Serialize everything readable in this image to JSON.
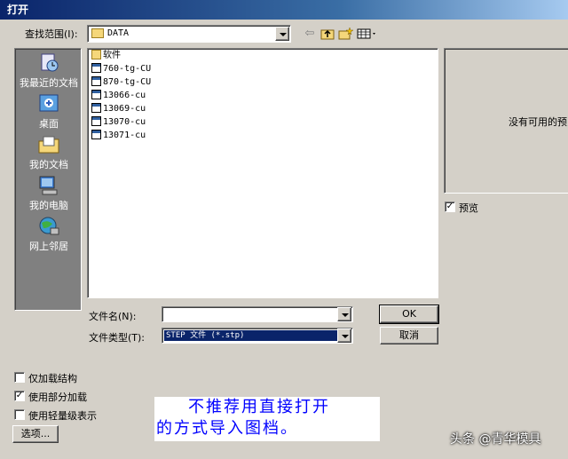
{
  "window": {
    "title": "打开"
  },
  "lookin": {
    "label": "查找范围(I):",
    "value": "DATA"
  },
  "places": [
    {
      "label": "我最近的文档",
      "icon": "recent-documents-icon"
    },
    {
      "label": "桌面",
      "icon": "desktop-icon"
    },
    {
      "label": "我的文档",
      "icon": "my-documents-icon"
    },
    {
      "label": "我的电脑",
      "icon": "my-computer-icon"
    },
    {
      "label": "网上邻居",
      "icon": "network-places-icon"
    }
  ],
  "files": [
    {
      "name": "软件",
      "type": "folder"
    },
    {
      "name": "760-tg-CU",
      "type": "file"
    },
    {
      "name": "870-tg-CU",
      "type": "file"
    },
    {
      "name": "13066-cu",
      "type": "file"
    },
    {
      "name": "13069-cu",
      "type": "file"
    },
    {
      "name": "13070-cu",
      "type": "file"
    },
    {
      "name": "13071-cu",
      "type": "file"
    }
  ],
  "preview": {
    "message": "没有可用的预览",
    "checkbox_label": "预览",
    "checked": true
  },
  "filename": {
    "label": "文件名(N):",
    "value": ""
  },
  "filetype": {
    "label": "文件类型(T):",
    "value": "STEP 文件 (*.stp)"
  },
  "buttons": {
    "ok": "OK",
    "cancel": "取消",
    "options": "选项..."
  },
  "options": [
    {
      "label": "仅加载结构",
      "checked": false
    },
    {
      "label": "使用部分加载",
      "checked": true
    },
    {
      "label": "使用轻量级表示",
      "checked": false
    }
  ],
  "annotation": {
    "line1": "不推荐用直接打开",
    "line2": "的方式导入图档。"
  },
  "watermark": "头条 @青华模具",
  "colors": {
    "titlebar": "#0a246a",
    "dialog": "#d4d0c8",
    "annotation": "#0000ff"
  }
}
